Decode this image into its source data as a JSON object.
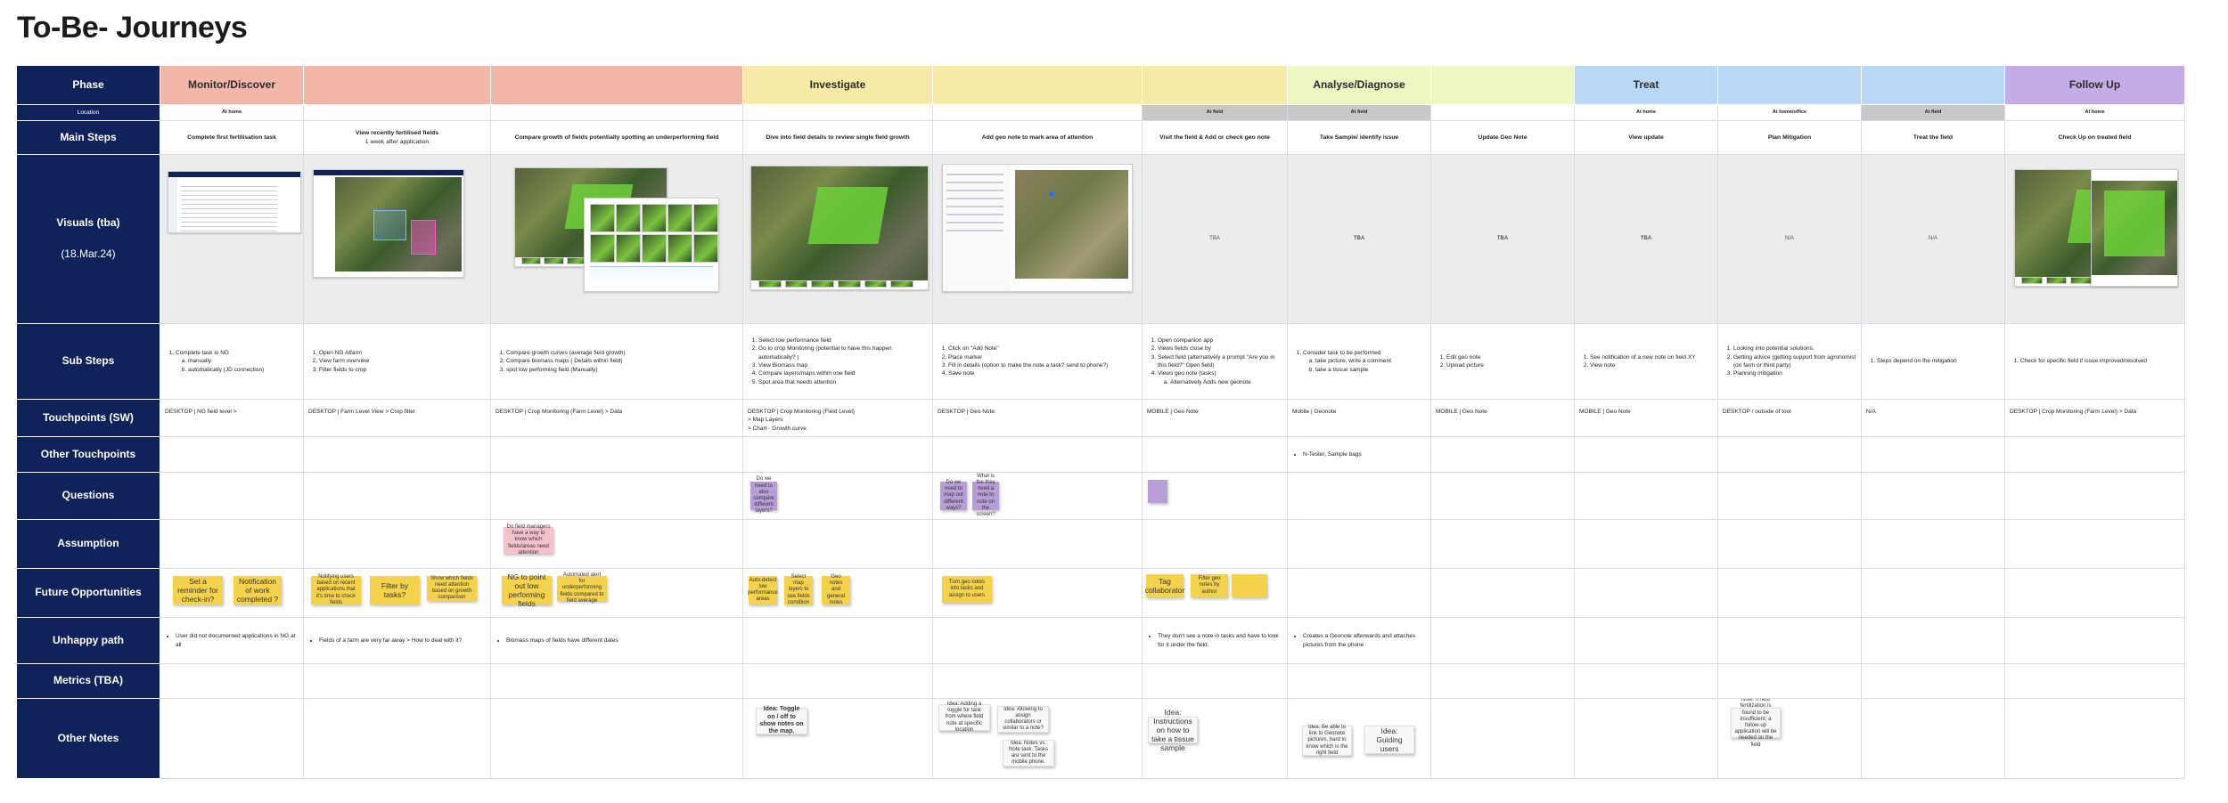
{
  "page": {
    "title": "To-Be- Journeys"
  },
  "labels": {
    "phase": "Phase",
    "location": "Location",
    "main_steps": "Main Steps",
    "visuals": "Visuals (tba)",
    "visuals_date": "(18.Mar.24)",
    "sub_steps": "Sub Steps",
    "touchpoints_sw": "Touchpoints (SW)",
    "other_touchpoints": "Other Touchpoints",
    "questions": "Questions",
    "assumption": "Assumption",
    "future_opportunities": "Future Opportunities",
    "unhappy_path": "Unhappy path",
    "metrics": "Metrics  (TBA)",
    "other_notes": "Other Notes"
  },
  "phases": [
    {
      "name": "Monitor/Discover",
      "color": "#f3b7aa"
    },
    {
      "name": "",
      "color": "#f3b7aa"
    },
    {
      "name": "",
      "color": "#f3b7aa"
    },
    {
      "name": "Investigate",
      "color": "#f7e9a6"
    },
    {
      "name": "",
      "color": "#f7e9a6"
    },
    {
      "name": "",
      "color": "#f7e9a6"
    },
    {
      "name": "Analyse/Diagnose",
      "color": "#eef6c4"
    },
    {
      "name": "",
      "color": "#eef6c4"
    },
    {
      "name": "Treat",
      "color": "#b9d8f6"
    },
    {
      "name": "",
      "color": "#b9d8f6"
    },
    {
      "name": "",
      "color": "#b9d8f6"
    },
    {
      "name": "Follow Up",
      "color": "#c4ade6"
    }
  ],
  "locations": [
    {
      "text": "At home",
      "bg": "#ffffff"
    },
    {
      "text": "",
      "bg": "#ffffff"
    },
    {
      "text": "",
      "bg": "#ffffff"
    },
    {
      "text": "",
      "bg": "#ffffff"
    },
    {
      "text": "",
      "bg": "#ffffff"
    },
    {
      "text": "At field",
      "bg": "#c8c8c8"
    },
    {
      "text": "At field",
      "bg": "#c8c8c8"
    },
    {
      "text": "",
      "bg": "#ffffff"
    },
    {
      "text": "At home",
      "bg": "#ffffff"
    },
    {
      "text": "At home/office",
      "bg": "#ffffff"
    },
    {
      "text": "At field",
      "bg": "#c8c8c8"
    },
    {
      "text": "At home",
      "bg": "#ffffff"
    }
  ],
  "main_steps": [
    {
      "title": "Complete first fertilisation task",
      "sub": ""
    },
    {
      "title": "View recently fertilised fields",
      "sub": "1 week after application"
    },
    {
      "title": "Compare growth of fields potentially spotting an underperforming field",
      "sub": ""
    },
    {
      "title": "Dive into field details to review single field growth",
      "sub": ""
    },
    {
      "title": "Add geo note to mark area of attention",
      "sub": ""
    },
    {
      "title": "Visit the field & Add or check geo note",
      "sub": ""
    },
    {
      "title": "Take Sample/ identify issue",
      "sub": ""
    },
    {
      "title": "Update Geo Note",
      "sub": ""
    },
    {
      "title": "View update",
      "sub": ""
    },
    {
      "title": "Plan Mitigation",
      "sub": ""
    },
    {
      "title": "Treat the field",
      "sub": ""
    },
    {
      "title": "Check Up on treated field",
      "sub": ""
    }
  ],
  "visual_texts": {
    "c6": "TBA",
    "c7": "TBA",
    "c8": "TBA",
    "c9": "TBA",
    "c10": "N/A",
    "c11": "N/A"
  },
  "sub_steps": {
    "c1": {
      "items": [
        "Complete task in NG"
      ],
      "sub": [
        "manually",
        "automatically (JD connection)"
      ]
    },
    "c2": {
      "items": [
        "Open NG Atfarm",
        "View farm overview",
        "Filter fields to crop"
      ]
    },
    "c3": {
      "items": [
        "Compare growth curves (average field growth)",
        "Compare biomass maps ( Details within field)",
        "spot low performing field (Manually)"
      ]
    },
    "c4": {
      "items": [
        "Select low performance field",
        "Go to crop Monitoring (potential to have this happen automatically? )",
        "View Biomass map",
        "Compare layers/maps within one field",
        "Spot area that needs attention"
      ]
    },
    "c5": {
      "items": [
        "Click on \"Add Note\"",
        "Place marker",
        "Fill in details (option to make the note a task? send to phone?)",
        "Save note"
      ]
    },
    "c6": {
      "items": [
        "Open companion app",
        "Views fields close by",
        "Select field (alternatively a prompt \"Are you in this field?\" Open field)",
        "Views geo note (tasks)"
      ],
      "sub": [
        "Alternatively Adds new geonote"
      ]
    },
    "c7": {
      "items": [
        "Consider task to be performed"
      ],
      "sub": [
        "take picture, write a comment",
        "take a tissue sample"
      ]
    },
    "c8": {
      "items": [
        "Edit geo note",
        "Upload picture"
      ]
    },
    "c9": {
      "items": [
        "See notification of a new note on field XY",
        "View note"
      ]
    },
    "c10": {
      "items": [
        "Looking into potential solutions.",
        "Getting advice (getting support from agronomist (on farm or third party)",
        "Planning mitigation"
      ]
    },
    "c11": {
      "items": [
        "Steps depend on the mitigation"
      ]
    },
    "c12": {
      "items": [
        "Check for specific field if issue improved/resolved"
      ]
    }
  },
  "touchpoints": [
    "DESKTOP | NG field level >",
    "DESKTOP | Farm Level View > Crop filter",
    "DESKTOP | Crop Monitoring (Farm Level) > Data",
    "DESKTOP | Crop Monitoring (Field Level)\n> Map Layers\n> Chart - Growth curve",
    "DESKTOP | Geo Note",
    "MOBILE | Geo Note",
    "Mobile | Geonote",
    "MOBILE | Geo Note",
    "MOBILE | Geo Note",
    "DESKTOP / outside of tool",
    "N/A",
    "DESKTOP | Crop Monitoring (Farm Level) > Data"
  ],
  "other_touchpoints": {
    "c7": "N-Tester, Sample bags"
  },
  "stickies": {
    "q1": "Do we need to also compare different layers?",
    "q2": "Do we need to map out different ways?",
    "q3": "What is the they need a note to note on the screen?",
    "a1": "Do field managers have a way to know which fields/areas need attention",
    "f1": "Set a reminder for check-in?",
    "f2": "Notification of work completed ?",
    "f3": "Notifying users based on recent applications that it's time to check fields",
    "f4": "Filter by tasks?",
    "f5": "Show which fields need attention based on growth comparison",
    "f6": "NG to point out low performing fields",
    "f7": "Automated alert for underperforming fields compared to field average",
    "f8": "Auto-detect low performance areas",
    "f9": "Select map layers to see fields condition",
    "f10": "Geo notes and general notes",
    "f11": "Turn geo notes into tasks and assign to users",
    "f12": "Tag collaborator",
    "f13": "Filter geo notes by author",
    "n1": "Idea: Toggle on / off to show notes on the map.",
    "n2": "Idea: Adding a toggle for task from where field note at specific location",
    "n3": "Idea: Allowing to assign collaborators or similar to a note?",
    "n4": "Idea: Notes vs. Note task. Tasks are sent to the mobile phone.",
    "n5": "Idea: Instructions on how to take a tissue sample",
    "n6": "Idea: Be able to link to Geonote pictures, hard to know which is the right field",
    "n7": "Idea: Guiding users",
    "n8": "Note: If field fertilization is found to be insufficient, a follow-up application will be needed on the field"
  },
  "unhappy": {
    "c1": "User did not documented applications in NG at all",
    "c2": "Fields of a farm are very far away > How to deal with it?",
    "c3": "Biomass maps of fields have different dates",
    "c6": "They don't see a note in tasks and have to look for it under the field.",
    "c7": "Creates a Geonote afterwards and attaches pictures from the phone"
  }
}
